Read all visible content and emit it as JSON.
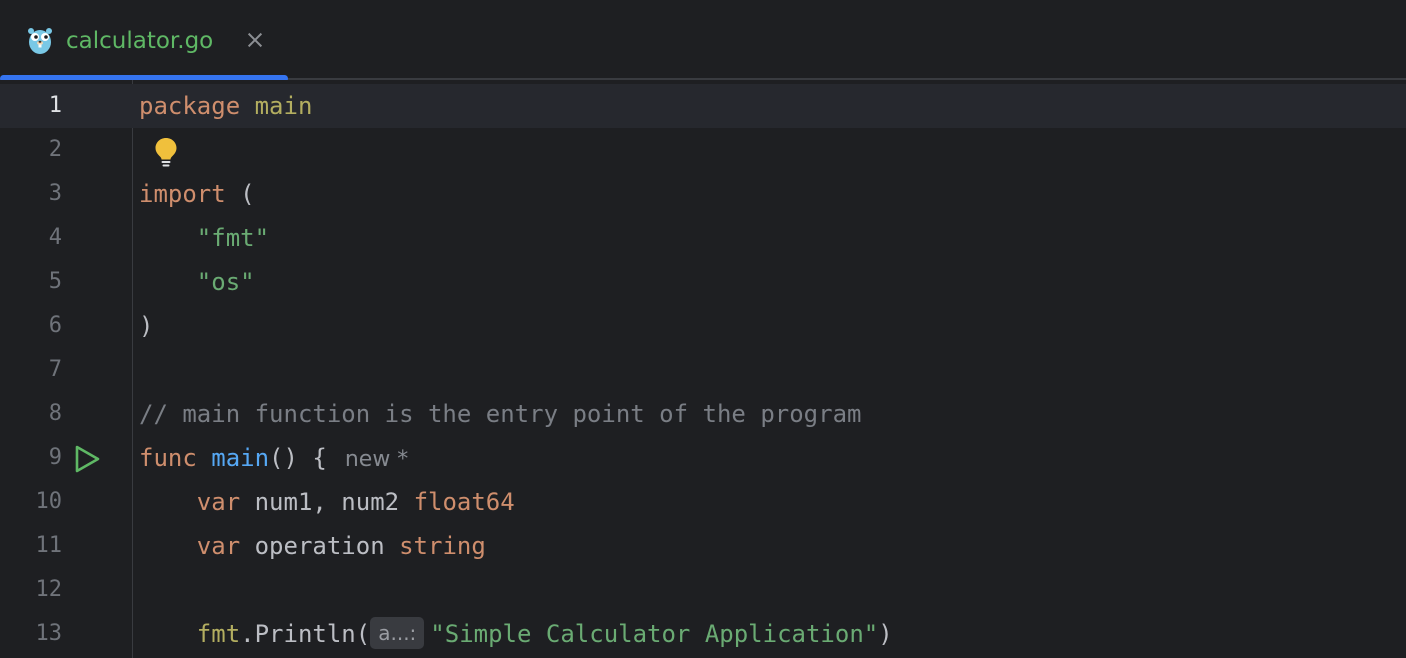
{
  "tab": {
    "filename": "calculator.go",
    "icon": "go-gopher-icon",
    "active_color": "#3574f0"
  },
  "editor": {
    "current_line": 1,
    "inlay_new": "new *",
    "param_hint": "a...:",
    "lines": [
      {
        "number": "1"
      },
      {
        "number": "2"
      },
      {
        "number": "3"
      },
      {
        "number": "4"
      },
      {
        "number": "5"
      },
      {
        "number": "6"
      },
      {
        "number": "7"
      },
      {
        "number": "8"
      },
      {
        "number": "9"
      },
      {
        "number": "10"
      },
      {
        "number": "11"
      },
      {
        "number": "12"
      },
      {
        "number": "13"
      }
    ],
    "code": {
      "l1_kw": "package",
      "l1_name": "main",
      "l3_kw": "import",
      "l3_paren": "(",
      "l4_str": "\"fmt\"",
      "l5_str": "\"os\"",
      "l6_paren": ")",
      "l8_comment": "// main function is the entry point of the program",
      "l9_kw": "func",
      "l9_name": "main",
      "l9_rest": "() {",
      "l10_kw": "var",
      "l10_idents": "num1, num2",
      "l10_type": "float64",
      "l11_kw": "var",
      "l11_ident": "operation",
      "l11_type": "string",
      "l13_pkg": "fmt",
      "l13_dot": ".",
      "l13_fn": "Println",
      "l13_open": "(",
      "l13_str": "\"Simple Calculator Application\"",
      "l13_close": ")"
    }
  },
  "colors": {
    "background": "#1e1f22",
    "current_line": "#26282e",
    "keyword": "#cf8e6d",
    "string": "#6aab73",
    "comment": "#7a7e85",
    "function": "#56a8f5",
    "tab_label": "#5fb865"
  }
}
